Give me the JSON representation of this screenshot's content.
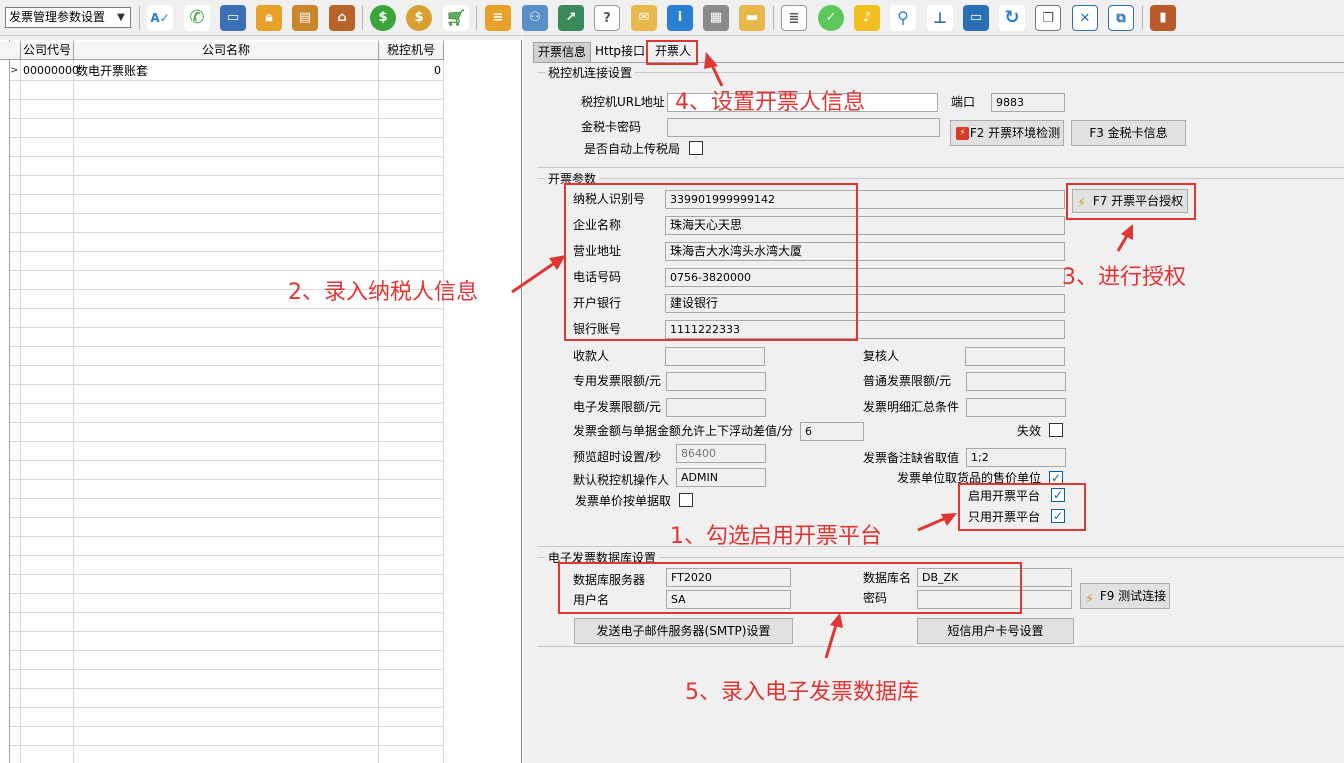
{
  "toolbar": {
    "module_select": "发票管理参数设置",
    "icons": [
      "spellcheck-icon",
      "phone-icon",
      "monitor-icon",
      "lock-icon",
      "briefcase-icon",
      "home-icon",
      "dollar-icon",
      "money-bag-icon",
      "cart-icon",
      "clipboard-icon",
      "users-icon",
      "link-icon",
      "help-icon",
      "mail-icon",
      "info-icon",
      "calculator-icon",
      "folder-icon",
      "document-icon",
      "check-icon",
      "bell-icon",
      "search-icon",
      "org-chart-icon",
      "screen-icon",
      "refresh-icon",
      "windows-icon",
      "close-icon",
      "window-restore-icon",
      "exit-door-icon"
    ],
    "colors": {
      "green": "#3aa53a",
      "orange": "#e8962a",
      "blue": "#2a7fd4",
      "red": "#d83a2a",
      "gray": "#8a8a8a"
    }
  },
  "grid": {
    "columns": [
      "公司代号",
      "公司名称",
      "税控机号"
    ],
    "rows": [
      {
        "code": "00000000",
        "name": "数电开票账套",
        "tax_no": "0"
      }
    ]
  },
  "tabs": [
    {
      "label": "开票信息",
      "active": true
    },
    {
      "label": "Http接口",
      "active": false
    },
    {
      "label": "开票人",
      "active": false
    }
  ],
  "tax_machine": {
    "group_title": "税控机连接设置",
    "url_label": "税控机URL地址",
    "url_value": "",
    "port_label": "端口",
    "port_value": "9883",
    "card_pwd_label": "金税卡密码",
    "card_pwd_value": "",
    "auto_upload_label": "是否自动上传税局",
    "auto_upload": false,
    "env_check_btn": "F2 开票环境检测",
    "card_info_btn": "F3 金税卡信息"
  },
  "invoice_params": {
    "group_title": "开票参数",
    "taxpayer_id_label": "纳税人识别号",
    "taxpayer_id": "339901999999142",
    "company_name_label": "企业名称",
    "company_name": "珠海天心天思",
    "address_label": "营业地址",
    "address": "珠海吉大水湾头水湾大厦",
    "phone_label": "电话号码",
    "phone": "0756-3820000",
    "bank_label": "开户银行",
    "bank": "建设银行",
    "account_label": "银行账号",
    "account": "1111222333",
    "authorize_btn": "F7 开票平台授权",
    "payee_label": "收款人",
    "payee": "",
    "reviewer_label": "复核人",
    "reviewer": "",
    "special_limit_label": "专用发票限额/元",
    "special_limit": "",
    "normal_limit_label": "普通发票限额/元",
    "normal_limit": "",
    "e_limit_label": "电子发票限额/元",
    "e_limit": "",
    "detail_cond_label": "发票明细汇总条件",
    "detail_cond": "",
    "float_label": "发票金额与单据金额允许上下浮动差值/分",
    "float_value": "6",
    "invalid_label": "失效",
    "invalid": false,
    "preview_timeout_label": "预览超时设置/秒",
    "preview_timeout": "86400",
    "remark_default_label": "发票备注缺省取值",
    "remark_default": "1;2",
    "operator_label": "默认税控机操作人",
    "operator": "ADMIN",
    "unit_price_label": "发票单位取货品的售价单位",
    "unit_price": true,
    "enable_platform_label": "启用开票平台",
    "enable_platform": true,
    "price_by_doc_label": "发票单价按单据取",
    "price_by_doc": false,
    "only_platform_label": "只用开票平台",
    "only_platform": true
  },
  "e_invoice_db": {
    "group_title": "电子发票数据库设置",
    "server_label": "数据库服务器",
    "server": "FT2020",
    "dbname_label": "数据库名",
    "dbname": "DB_ZK",
    "user_label": "用户名",
    "user": "SA",
    "pwd_label": "密码",
    "pwd": "",
    "test_btn": "F9 测试连接",
    "smtp_btn": "发送电子邮件服务器(SMTP)设置",
    "sms_btn": "短信用户卡号设置"
  },
  "annotations": {
    "a1": "1、勾选启用开票平台",
    "a2": "2、录入纳税人信息",
    "a3": "3、进行授权",
    "a4": "4、设置开票人信息",
    "a5": "5、录入电子发票数据库",
    "color": "#e03535"
  }
}
